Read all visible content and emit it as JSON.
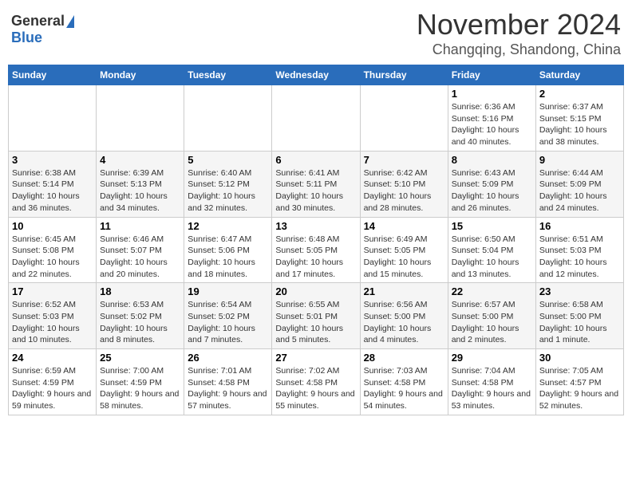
{
  "header": {
    "logo_general": "General",
    "logo_blue": "Blue",
    "month": "November 2024",
    "location": "Changqing, Shandong, China"
  },
  "weekdays": [
    "Sunday",
    "Monday",
    "Tuesday",
    "Wednesday",
    "Thursday",
    "Friday",
    "Saturday"
  ],
  "weeks": [
    [
      {
        "day": "",
        "info": ""
      },
      {
        "day": "",
        "info": ""
      },
      {
        "day": "",
        "info": ""
      },
      {
        "day": "",
        "info": ""
      },
      {
        "day": "",
        "info": ""
      },
      {
        "day": "1",
        "info": "Sunrise: 6:36 AM\nSunset: 5:16 PM\nDaylight: 10 hours and 40 minutes."
      },
      {
        "day": "2",
        "info": "Sunrise: 6:37 AM\nSunset: 5:15 PM\nDaylight: 10 hours and 38 minutes."
      }
    ],
    [
      {
        "day": "3",
        "info": "Sunrise: 6:38 AM\nSunset: 5:14 PM\nDaylight: 10 hours and 36 minutes."
      },
      {
        "day": "4",
        "info": "Sunrise: 6:39 AM\nSunset: 5:13 PM\nDaylight: 10 hours and 34 minutes."
      },
      {
        "day": "5",
        "info": "Sunrise: 6:40 AM\nSunset: 5:12 PM\nDaylight: 10 hours and 32 minutes."
      },
      {
        "day": "6",
        "info": "Sunrise: 6:41 AM\nSunset: 5:11 PM\nDaylight: 10 hours and 30 minutes."
      },
      {
        "day": "7",
        "info": "Sunrise: 6:42 AM\nSunset: 5:10 PM\nDaylight: 10 hours and 28 minutes."
      },
      {
        "day": "8",
        "info": "Sunrise: 6:43 AM\nSunset: 5:09 PM\nDaylight: 10 hours and 26 minutes."
      },
      {
        "day": "9",
        "info": "Sunrise: 6:44 AM\nSunset: 5:09 PM\nDaylight: 10 hours and 24 minutes."
      }
    ],
    [
      {
        "day": "10",
        "info": "Sunrise: 6:45 AM\nSunset: 5:08 PM\nDaylight: 10 hours and 22 minutes."
      },
      {
        "day": "11",
        "info": "Sunrise: 6:46 AM\nSunset: 5:07 PM\nDaylight: 10 hours and 20 minutes."
      },
      {
        "day": "12",
        "info": "Sunrise: 6:47 AM\nSunset: 5:06 PM\nDaylight: 10 hours and 18 minutes."
      },
      {
        "day": "13",
        "info": "Sunrise: 6:48 AM\nSunset: 5:05 PM\nDaylight: 10 hours and 17 minutes."
      },
      {
        "day": "14",
        "info": "Sunrise: 6:49 AM\nSunset: 5:05 PM\nDaylight: 10 hours and 15 minutes."
      },
      {
        "day": "15",
        "info": "Sunrise: 6:50 AM\nSunset: 5:04 PM\nDaylight: 10 hours and 13 minutes."
      },
      {
        "day": "16",
        "info": "Sunrise: 6:51 AM\nSunset: 5:03 PM\nDaylight: 10 hours and 12 minutes."
      }
    ],
    [
      {
        "day": "17",
        "info": "Sunrise: 6:52 AM\nSunset: 5:03 PM\nDaylight: 10 hours and 10 minutes."
      },
      {
        "day": "18",
        "info": "Sunrise: 6:53 AM\nSunset: 5:02 PM\nDaylight: 10 hours and 8 minutes."
      },
      {
        "day": "19",
        "info": "Sunrise: 6:54 AM\nSunset: 5:02 PM\nDaylight: 10 hours and 7 minutes."
      },
      {
        "day": "20",
        "info": "Sunrise: 6:55 AM\nSunset: 5:01 PM\nDaylight: 10 hours and 5 minutes."
      },
      {
        "day": "21",
        "info": "Sunrise: 6:56 AM\nSunset: 5:00 PM\nDaylight: 10 hours and 4 minutes."
      },
      {
        "day": "22",
        "info": "Sunrise: 6:57 AM\nSunset: 5:00 PM\nDaylight: 10 hours and 2 minutes."
      },
      {
        "day": "23",
        "info": "Sunrise: 6:58 AM\nSunset: 5:00 PM\nDaylight: 10 hours and 1 minute."
      }
    ],
    [
      {
        "day": "24",
        "info": "Sunrise: 6:59 AM\nSunset: 4:59 PM\nDaylight: 9 hours and 59 minutes."
      },
      {
        "day": "25",
        "info": "Sunrise: 7:00 AM\nSunset: 4:59 PM\nDaylight: 9 hours and 58 minutes."
      },
      {
        "day": "26",
        "info": "Sunrise: 7:01 AM\nSunset: 4:58 PM\nDaylight: 9 hours and 57 minutes."
      },
      {
        "day": "27",
        "info": "Sunrise: 7:02 AM\nSunset: 4:58 PM\nDaylight: 9 hours and 55 minutes."
      },
      {
        "day": "28",
        "info": "Sunrise: 7:03 AM\nSunset: 4:58 PM\nDaylight: 9 hours and 54 minutes."
      },
      {
        "day": "29",
        "info": "Sunrise: 7:04 AM\nSunset: 4:58 PM\nDaylight: 9 hours and 53 minutes."
      },
      {
        "day": "30",
        "info": "Sunrise: 7:05 AM\nSunset: 4:57 PM\nDaylight: 9 hours and 52 minutes."
      }
    ]
  ]
}
